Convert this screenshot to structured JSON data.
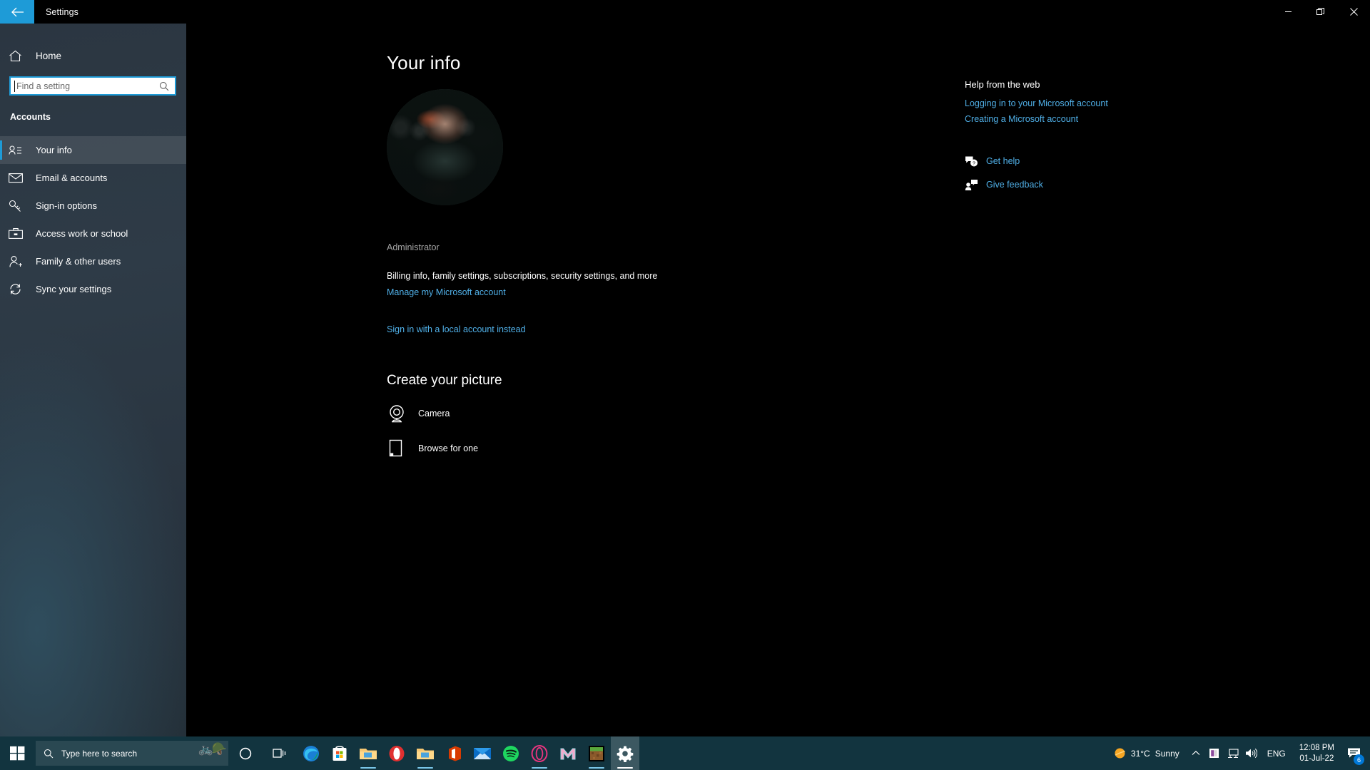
{
  "window": {
    "title": "Settings",
    "back_icon": "back-arrow-icon",
    "minimize_label": "─",
    "maximize_label": "❐",
    "close_label": "✕"
  },
  "sidebar": {
    "home_label": "Home",
    "search": {
      "placeholder": "Find a setting",
      "value": "",
      "icon": "search-icon"
    },
    "section_header": "Accounts",
    "items": [
      {
        "label": "Your info",
        "icon": "contact-info-icon",
        "selected": true
      },
      {
        "label": "Email & accounts",
        "icon": "mail-icon",
        "selected": false
      },
      {
        "label": "Sign-in options",
        "icon": "key-icon",
        "selected": false
      },
      {
        "label": "Access work or school",
        "icon": "briefcase-icon",
        "selected": false
      },
      {
        "label": "Family & other users",
        "icon": "person-add-icon",
        "selected": false
      },
      {
        "label": "Sync your settings",
        "icon": "sync-icon",
        "selected": false
      }
    ]
  },
  "main": {
    "page_title": "Your info",
    "avatar_alt": "account-profile-photo",
    "account_name": "",
    "account_role": "Administrator",
    "billing_text": "Billing info, family settings, subscriptions, security settings, and more",
    "manage_account_link": "Manage my Microsoft account",
    "local_account_link": "Sign in with a local account instead",
    "create_picture_title": "Create your picture",
    "camera_label": "Camera",
    "camera_icon": "webcam-icon",
    "browse_label": "Browse for one",
    "browse_icon": "file-picture-icon"
  },
  "help": {
    "title": "Help from the web",
    "links": [
      "Logging in to your Microsoft account",
      "Creating a Microsoft account"
    ],
    "support": [
      {
        "label": "Get help",
        "icon": "help-chat-icon"
      },
      {
        "label": "Give feedback",
        "icon": "feedback-person-icon"
      }
    ]
  },
  "taskbar": {
    "start_icon": "windows-start-icon",
    "search_placeholder": "Type here to search",
    "search_icon": "search-icon",
    "doodle_icon": "bicycle-helmet-doodle",
    "cortana_icon": "cortana-icon",
    "taskview_icon": "task-view-icon",
    "apps": [
      {
        "name": "microsoft-edge",
        "label": "Microsoft Edge",
        "open": false
      },
      {
        "name": "microsoft-store",
        "label": "Microsoft Store",
        "open": false
      },
      {
        "name": "file-explorer",
        "label": "File Explorer",
        "open": true
      },
      {
        "name": "opera-browser",
        "label": "Opera",
        "open": false
      },
      {
        "name": "file-explorer-2",
        "label": "File Explorer",
        "open": true
      },
      {
        "name": "microsoft-office",
        "label": "Office",
        "open": false
      },
      {
        "name": "mail",
        "label": "Mail",
        "open": false
      },
      {
        "name": "spotify",
        "label": "Spotify",
        "open": false
      },
      {
        "name": "opera-gx",
        "label": "Opera GX",
        "open": true
      },
      {
        "name": "mega",
        "label": "MEGA",
        "open": false
      },
      {
        "name": "minecraft",
        "label": "Minecraft",
        "open": true
      },
      {
        "name": "settings",
        "label": "Settings",
        "open": true,
        "active": true
      }
    ],
    "tray": {
      "weather_icon": "sun-icon",
      "temperature": "31°C",
      "condition": "Sunny",
      "chevron_icon": "chevron-up-icon",
      "onedrive_icon": "tray-app-icon",
      "network_icon": "network-icon",
      "volume_icon": "volume-icon",
      "language": "ENG",
      "time": "12:08 PM",
      "date": "01-Jul-22",
      "notification_icon": "action-center-icon",
      "notification_count": "6"
    }
  },
  "colors": {
    "accent": "#1e9bd7",
    "link": "#50b0e8",
    "taskbar": "#12343f",
    "content_bg": "#000000"
  }
}
